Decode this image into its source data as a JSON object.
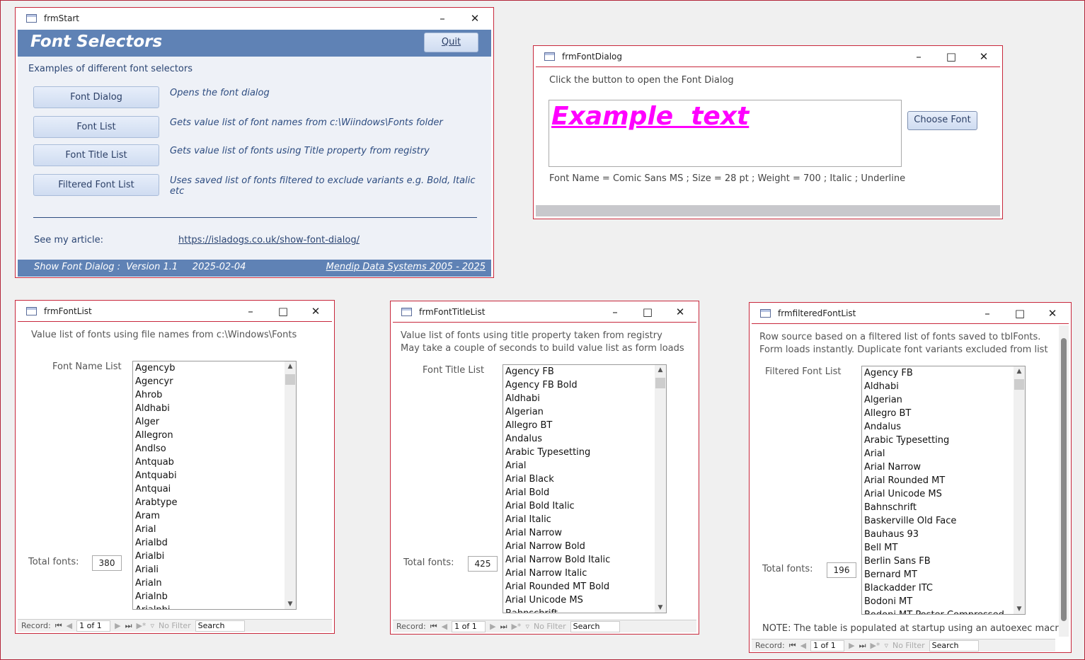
{
  "frmStart": {
    "title": "frmStart",
    "heading": "Font Selectors",
    "quit": "Quit",
    "intro": "Examples of different font selectors",
    "buttons": [
      {
        "label": "Font Dialog",
        "desc": "Opens the font dialog"
      },
      {
        "label": "Font List",
        "desc": "Gets value list of font names from c:\\Wiindows\\Fonts folder"
      },
      {
        "label": "Font Title List",
        "desc": "Gets value list of fonts using Title property from registry"
      },
      {
        "label": "Filtered Font List",
        "desc": "Uses saved list of fonts filtered to exclude variants e.g. Bold, Italic etc"
      }
    ],
    "article_label": "See my article:",
    "article_link": "https://isladogs.co.uk/show-font-dialog/",
    "footer_left": "Show Font Dialog :  Version 1.1     2025-02-04",
    "footer_right": "Mendip Data Systems 2005 - 2025",
    "header_color": "#5f82b5"
  },
  "frmFontDialog": {
    "title": "frmFontDialog",
    "instruction": "Click the button to open the Font Dialog",
    "example": "Example  text",
    "example_color": "#ff00ff",
    "choose": "Choose Font",
    "info": "Font Name = Comic Sans MS ; Size = 28 pt ; Weight = 700 ; Italic ; Underline"
  },
  "nav": {
    "record": "Record:",
    "pos": "1 of 1",
    "filter": "No Filter",
    "search": "Search"
  },
  "frmFontList": {
    "title": "frmFontList",
    "desc": "Value list of fonts using file names from c:\\Windows\\Fonts",
    "list_label": "Font Name List",
    "total_label": "Total fonts:",
    "total": "380",
    "items": [
      "Agencyb",
      "Agencyr",
      "Ahrob",
      "Aldhabi",
      "Alger",
      "Allegron",
      "Andlso",
      "Antquab",
      "Antquabi",
      "Antquai",
      "Arabtype",
      "Aram",
      "Arial",
      "Arialbd",
      "Arialbi",
      "Ariali",
      "Arialn",
      "Arialnb",
      "Arialnbi"
    ]
  },
  "frmFontTitleList": {
    "title": "frmFontTitleList",
    "desc1": "Value list of fonts using title property taken from registry",
    "desc2": "May take a couple of seconds to build value list as form loads",
    "list_label": "Font Title List",
    "total_label": "Total fonts:",
    "total": "425",
    "items": [
      "Agency FB",
      "Agency FB Bold",
      "Aldhabi",
      "Algerian",
      "Allegro BT",
      "Andalus",
      "Arabic Typesetting",
      "Arial",
      "Arial Black",
      "Arial Bold",
      "Arial Bold Italic",
      "Arial Italic",
      "Arial Narrow",
      "Arial Narrow Bold",
      "Arial Narrow Bold Italic",
      "Arial Narrow Italic",
      "Arial Rounded MT Bold",
      "Arial Unicode MS",
      "Bahnschrift"
    ]
  },
  "frmfilteredFontList": {
    "title": "frmfilteredFontList",
    "desc1": "Row source based on a filtered list of fonts saved to tblFonts.",
    "desc2": "Form loads instantly. Duplicate font variants excluded from list",
    "list_label": "Filtered Font List",
    "total_label": "Total fonts:",
    "total": "196",
    "note": "NOTE: The table is populated at startup using an autoexec macro",
    "items": [
      "Agency FB",
      "Aldhabi",
      "Algerian",
      "Allegro BT",
      "Andalus",
      "Arabic Typesetting",
      "Arial",
      "Arial Narrow",
      "Arial Rounded MT",
      "Arial Unicode MS",
      "Bahnschrift",
      "Baskerville Old Face",
      "Bauhaus 93",
      "Bell MT",
      "Berlin Sans FB",
      "Bernard MT",
      "Blackadder ITC",
      "Bodoni MT",
      "Bodoni MT Poster Compressed"
    ]
  }
}
